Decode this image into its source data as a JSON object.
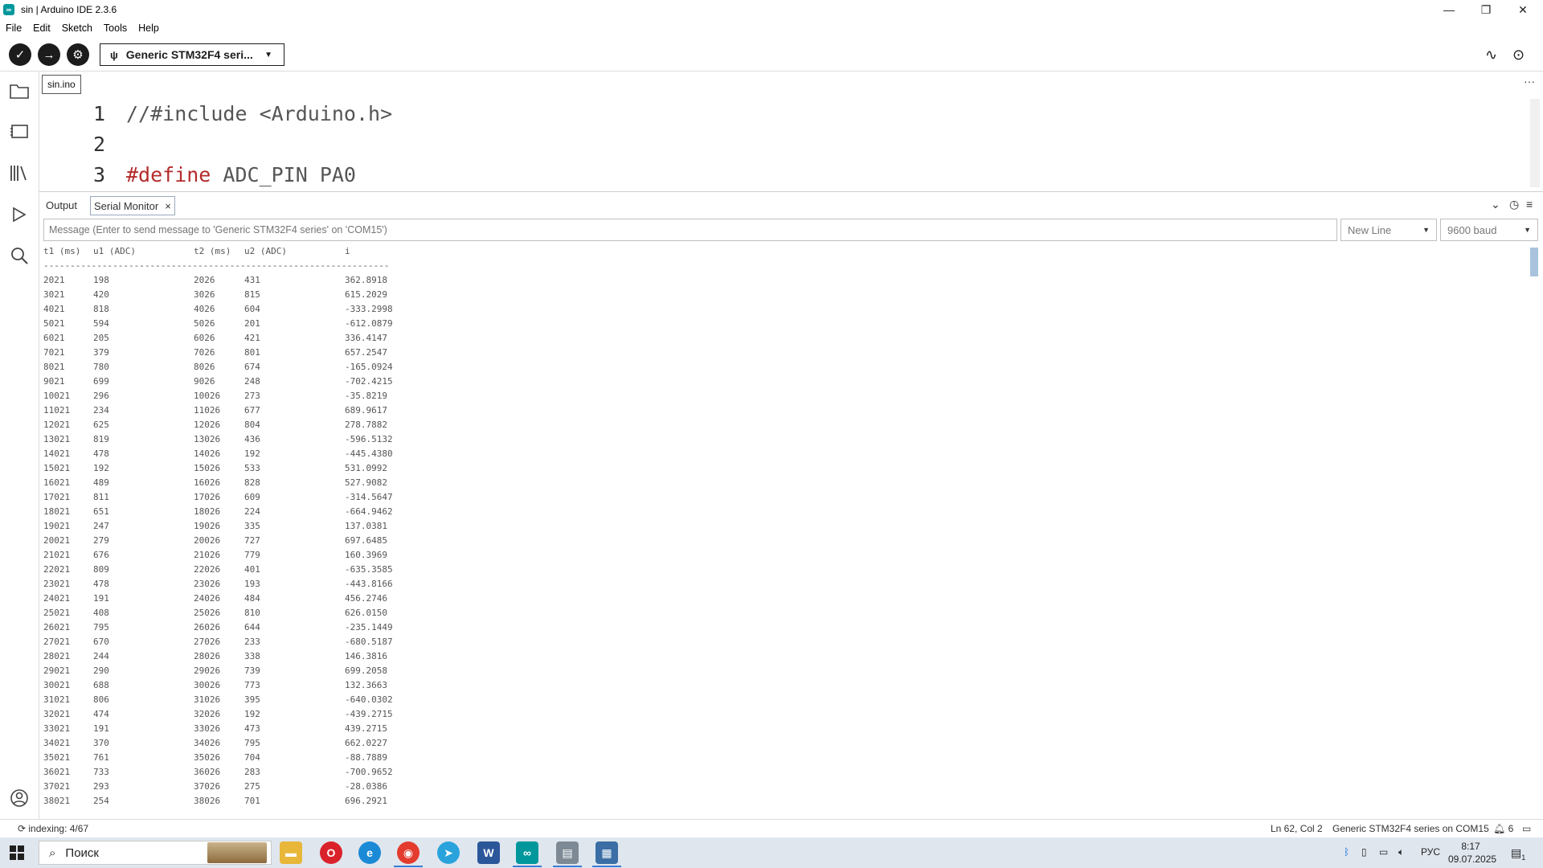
{
  "window": {
    "title": "sin | Arduino IDE 2.3.6",
    "app_icon_glyph": "∞"
  },
  "menu": [
    "File",
    "Edit",
    "Sketch",
    "Tools",
    "Help"
  ],
  "toolbar": {
    "verify_icon": "✓",
    "upload_icon": "→",
    "debug_icon": "⚙",
    "board_label": "Generic STM32F4 seri...",
    "usb_icon": "ψ",
    "plotter_icon": "∿",
    "monitor_icon": "⊙"
  },
  "editor": {
    "tab": "sin.ino",
    "more": "···",
    "lines": [
      {
        "num": "1",
        "pre": "",
        "kw": "",
        "text": "//#include <Arduino.h>"
      },
      {
        "num": "2",
        "pre": "",
        "kw": "",
        "text": ""
      },
      {
        "num": "3",
        "pre": "",
        "kw": "#define",
        "text": " ADC_PIN PA0"
      }
    ]
  },
  "panel": {
    "tabs": [
      {
        "label": "Output"
      },
      {
        "label": "Serial Monitor",
        "close": "×"
      }
    ],
    "icons": {
      "collapse": "⌄",
      "timestamp": "◷",
      "clear": "≡"
    },
    "message_placeholder": "Message (Enter to send message to 'Generic STM32F4 series' on 'COM15')",
    "line_ending": "New Line",
    "baud": "9600 baud",
    "dropdown_arrow": "▼"
  },
  "serial": {
    "header": [
      "t1 (ms)",
      "u1 (ADC)",
      "t2 (ms)",
      "u2 (ADC)",
      "i"
    ],
    "separator": "-----------------------------------------------------------------",
    "rows": [
      [
        "2021",
        "198",
        "2026",
        "431",
        "362.8918"
      ],
      [
        "3021",
        "420",
        "3026",
        "815",
        "615.2029"
      ],
      [
        "4021",
        "818",
        "4026",
        "604",
        "-333.2998"
      ],
      [
        "5021",
        "594",
        "5026",
        "201",
        "-612.0879"
      ],
      [
        "6021",
        "205",
        "6026",
        "421",
        "336.4147"
      ],
      [
        "7021",
        "379",
        "7026",
        "801",
        "657.2547"
      ],
      [
        "8021",
        "780",
        "8026",
        "674",
        "-165.0924"
      ],
      [
        "9021",
        "699",
        "9026",
        "248",
        "-702.4215"
      ],
      [
        "10021",
        "296",
        "10026",
        "273",
        "-35.8219"
      ],
      [
        "11021",
        "234",
        "11026",
        "677",
        "689.9617"
      ],
      [
        "12021",
        "625",
        "12026",
        "804",
        "278.7882"
      ],
      [
        "13021",
        "819",
        "13026",
        "436",
        "-596.5132"
      ],
      [
        "14021",
        "478",
        "14026",
        "192",
        "-445.4380"
      ],
      [
        "15021",
        "192",
        "15026",
        "533",
        "531.0992"
      ],
      [
        "16021",
        "489",
        "16026",
        "828",
        "527.9082"
      ],
      [
        "17021",
        "811",
        "17026",
        "609",
        "-314.5647"
      ],
      [
        "18021",
        "651",
        "18026",
        "224",
        "-664.9462"
      ],
      [
        "19021",
        "247",
        "19026",
        "335",
        "137.0381"
      ],
      [
        "20021",
        "279",
        "20026",
        "727",
        "697.6485"
      ],
      [
        "21021",
        "676",
        "21026",
        "779",
        "160.3969"
      ],
      [
        "22021",
        "809",
        "22026",
        "401",
        "-635.3585"
      ],
      [
        "23021",
        "478",
        "23026",
        "193",
        "-443.8166"
      ],
      [
        "24021",
        "191",
        "24026",
        "484",
        "456.2746"
      ],
      [
        "25021",
        "408",
        "25026",
        "810",
        "626.0150"
      ],
      [
        "26021",
        "795",
        "26026",
        "644",
        "-235.1449"
      ],
      [
        "27021",
        "670",
        "27026",
        "233",
        "-680.5187"
      ],
      [
        "28021",
        "244",
        "28026",
        "338",
        "146.3816"
      ],
      [
        "29021",
        "290",
        "29026",
        "739",
        "699.2058"
      ],
      [
        "30021",
        "688",
        "30026",
        "773",
        "132.3663"
      ],
      [
        "31021",
        "806",
        "31026",
        "395",
        "-640.0302"
      ],
      [
        "32021",
        "474",
        "32026",
        "192",
        "-439.2715"
      ],
      [
        "33021",
        "191",
        "33026",
        "473",
        "439.2715"
      ],
      [
        "34021",
        "370",
        "34026",
        "795",
        "662.0227"
      ],
      [
        "35021",
        "761",
        "35026",
        "704",
        "-88.7889"
      ],
      [
        "36021",
        "733",
        "36026",
        "283",
        "-700.9652"
      ],
      [
        "37021",
        "293",
        "37026",
        "275",
        "-28.0386"
      ],
      [
        "38021",
        "254",
        "38026",
        "701",
        "696.2921"
      ]
    ]
  },
  "status": {
    "indexing": "indexing: 4/67",
    "position": "Ln 62, Col 2",
    "board_port": "Generic STM32F4 series on COM15",
    "notifications": "6"
  },
  "taskbar": {
    "search_label": "Поиск",
    "lang": "РУС",
    "time": "8:17",
    "date": "09.07.2025",
    "notif_count": "1"
  }
}
